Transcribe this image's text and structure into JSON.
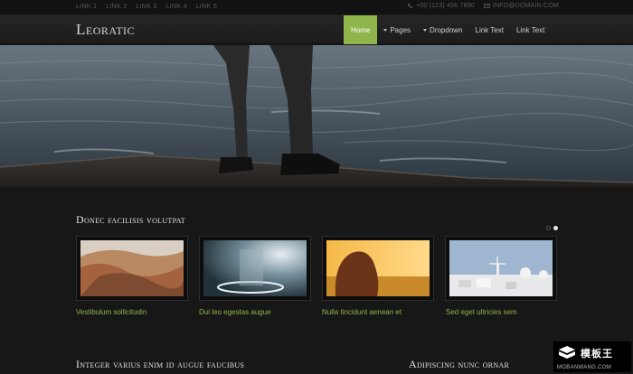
{
  "topbar": {
    "links": [
      "LINK 1",
      "LINK 2",
      "LINK 3",
      "LINK 4",
      "LINK 5"
    ],
    "phone": "+00 (123) 456 7890",
    "email": "INFO@DOMAIN.COM"
  },
  "header": {
    "logo": "Leoratic",
    "nav": [
      {
        "label": "Home",
        "active": true,
        "dropdown": false
      },
      {
        "label": "Pages",
        "active": false,
        "dropdown": true
      },
      {
        "label": "Dropdown",
        "active": false,
        "dropdown": true
      },
      {
        "label": "Link Text",
        "active": false,
        "dropdown": false
      },
      {
        "label": "Link Text",
        "active": false,
        "dropdown": false
      }
    ]
  },
  "portfolio": {
    "title": "Donec facilisis volutpat",
    "items": [
      {
        "caption": "Vestibulum sollicitudin"
      },
      {
        "caption": "Dui leo egestas augue"
      },
      {
        "caption": "Nulla tincidunt aenean et"
      },
      {
        "caption": "Sed eget ultricies sem"
      }
    ]
  },
  "section2": {
    "title": "Integer varius enim id augue faucibus"
  },
  "section3": {
    "title": "Adipiscing nunc ornar"
  },
  "watermark": {
    "cn": "模板王",
    "en": "MOBANWANG.COM"
  },
  "colors": {
    "accent": "#8fb54b",
    "background": "#171717"
  }
}
